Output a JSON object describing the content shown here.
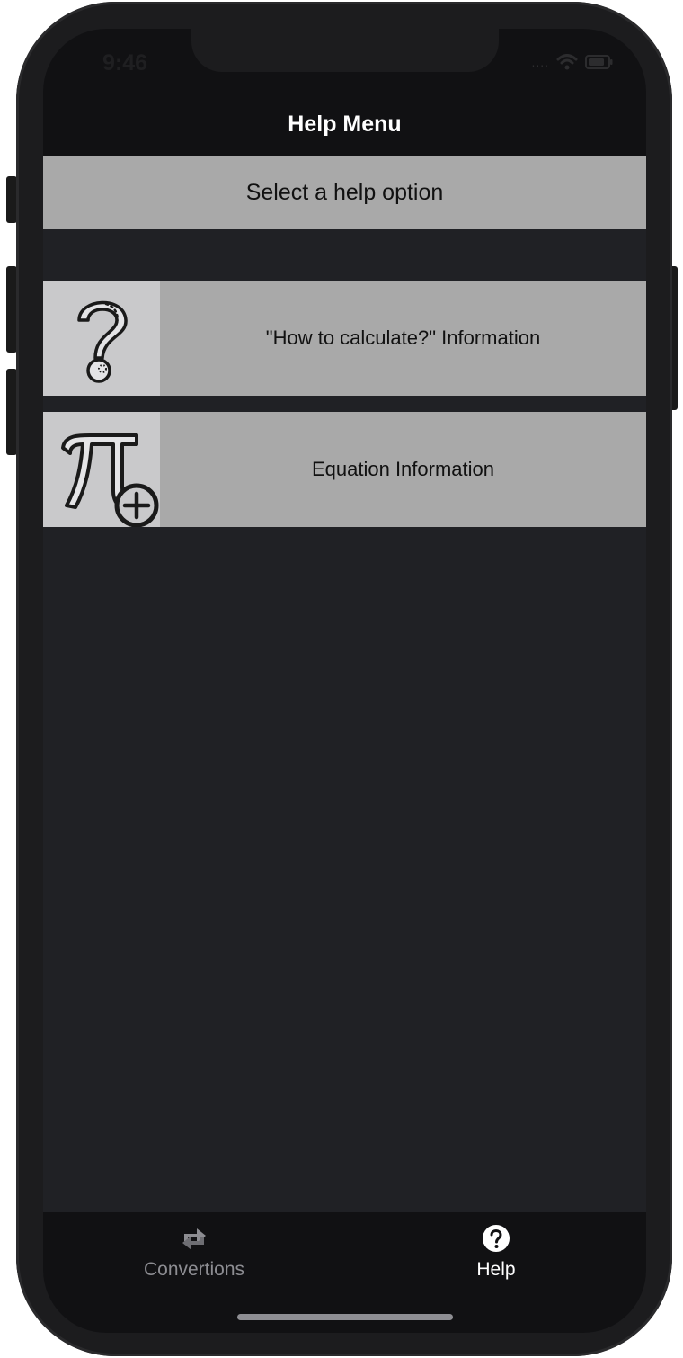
{
  "status_bar": {
    "time": "9:46",
    "signal_icon": "signal-dots-icon",
    "wifi_icon": "wifi-icon",
    "battery_icon": "battery-icon"
  },
  "nav": {
    "title": "Help Menu"
  },
  "header": {
    "text": "Select a help option"
  },
  "help_options": [
    {
      "label": "\"How to calculate?\" Information",
      "icon": "question-mark-icon"
    },
    {
      "label": "Equation Information",
      "icon": "pi-plus-icon"
    }
  ],
  "tab_bar": {
    "tabs": [
      {
        "label": "Convertions",
        "icon": "convert-arrows-icon",
        "selected": false
      },
      {
        "label": "Help",
        "icon": "help-circle-icon",
        "selected": true
      }
    ]
  },
  "colors": {
    "background": "#202125",
    "bar": "#111113",
    "row": "#a9a9a9",
    "icon_tile": "#c9c9cb",
    "tab_inactive": "#8d8d92",
    "tab_active": "#ffffff"
  }
}
